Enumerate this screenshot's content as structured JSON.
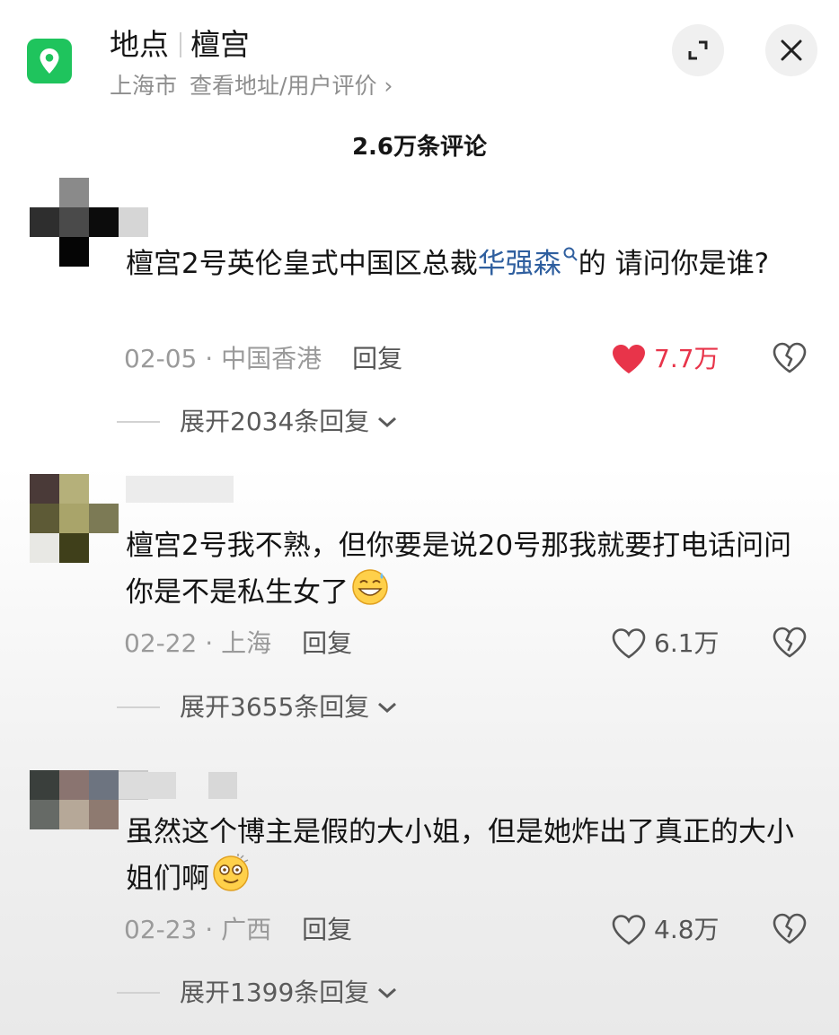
{
  "header": {
    "title_label": "地点",
    "place_name": "檀宫",
    "city": "上海市",
    "view_link": "查看地址/用户评价",
    "view_link_chevron": "›"
  },
  "comments_title": "2.6万条评论",
  "comments": [
    {
      "text_before": "檀宫2号英伦皇式中国区总裁",
      "mention": "华强森",
      "text_after": "的 请问你是谁?",
      "date": "02-05",
      "location": "中国香港",
      "reply_label": "回复",
      "likes": "7.7万",
      "liked": true,
      "expand_label": "展开2034条回复"
    },
    {
      "text": "檀宫2号我不熟，但你要是说20号那我就要打电话问问你是不是私生女了",
      "date": "02-22",
      "location": "上海",
      "reply_label": "回复",
      "likes": "6.1万",
      "liked": false,
      "expand_label": "展开3655条回复"
    },
    {
      "text": "虽然这个博主是假的大小姐，但是她炸出了真正的大小姐们啊",
      "date": "02-23",
      "location": "广西",
      "reply_label": "回复",
      "likes": "4.8万",
      "liked": false,
      "expand_label": "展开1399条回复"
    }
  ],
  "meta_separator": "·",
  "icons": {
    "location": "location-pin-icon",
    "expand": "expand-window-icon",
    "close": "close-icon",
    "like": "heart-icon",
    "dislike": "broken-heart-icon",
    "search": "search-icon",
    "chevron": "chevron-down-icon"
  },
  "colors": {
    "brand_green": "#1fc45d",
    "like_red": "#e8344a",
    "mention_blue": "#2f5f9f"
  }
}
